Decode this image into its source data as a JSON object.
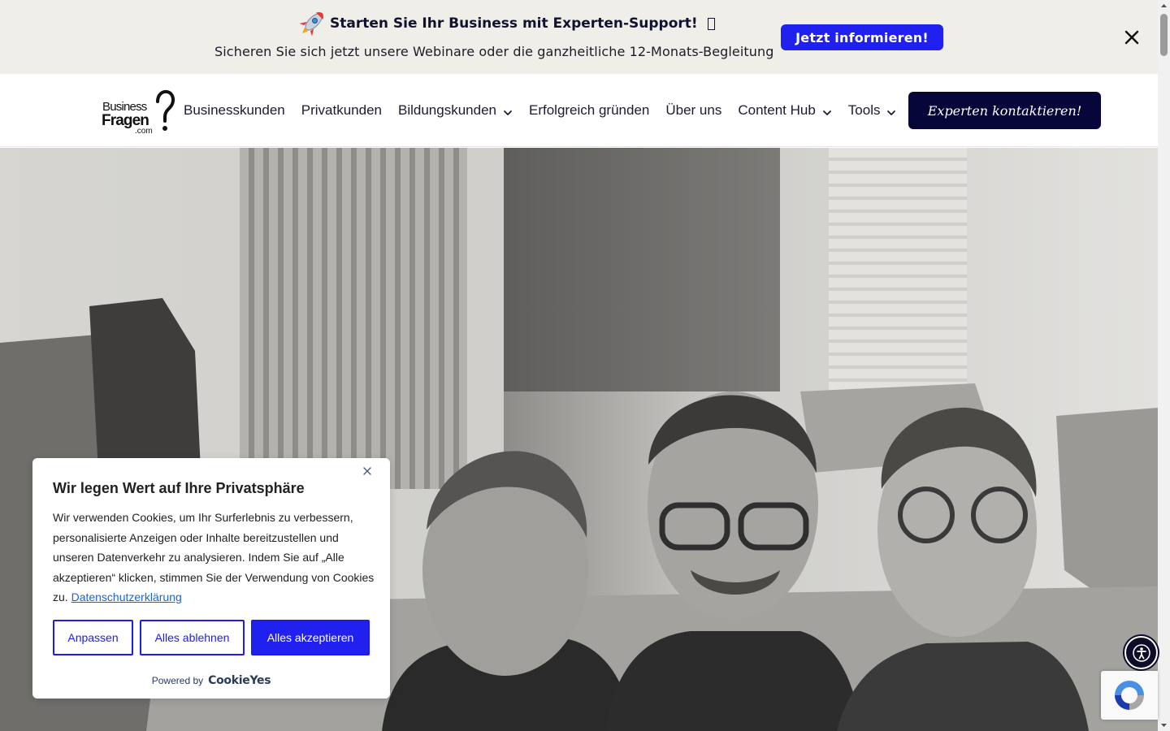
{
  "promo": {
    "icon": "rocket-icon",
    "title": "Starten Sie Ihr Business mit Experten-Support!",
    "subtitle": "Sicheren Sie sich jetzt unsere Webinare oder die ganzheitliche 12-Monats-Begleitung",
    "cta": "Jetzt informieren!",
    "close_icon": "close-icon"
  },
  "header": {
    "logo": {
      "line1": "Business",
      "line2": "Fragen",
      "line3": ".com"
    },
    "nav": [
      {
        "label": "Businesskunden",
        "dropdown": false
      },
      {
        "label": "Privatkunden",
        "dropdown": false
      },
      {
        "label": "Bildungskunden",
        "dropdown": true
      },
      {
        "label": "Erfolgreich gründen",
        "dropdown": false
      },
      {
        "label": "Über uns",
        "dropdown": false
      },
      {
        "label": "Content Hub",
        "dropdown": true
      },
      {
        "label": "Tools",
        "dropdown": true
      }
    ],
    "cta": "Experten kontaktieren!"
  },
  "cookie": {
    "title": "Wir legen Wert auf Ihre Privatsphäre",
    "text": "Wir verwenden Cookies, um Ihr Surferlebnis zu verbessern, personalisierte Anzeigen oder Inhalte bereitzustellen und unseren Datenverkehr zu analysieren. Indem Sie auf „Alle akzeptieren“ klicken, stimmen Sie der Verwendung von Cookies zu.",
    "link": "Datenschutzerklärung",
    "buttons": {
      "customize": "Anpassen",
      "reject": "Alles ablehnen",
      "accept": "Alles akzeptieren"
    },
    "powered_by": "Powered by",
    "brand": "CookieYes"
  },
  "colors": {
    "accent": "#2020EF",
    "navy": "#06063A",
    "banner_bg": "#EFEEE8"
  },
  "widgets": {
    "accessibility_icon": "accessibility-icon",
    "recaptcha_icon": "recaptcha-icon"
  }
}
